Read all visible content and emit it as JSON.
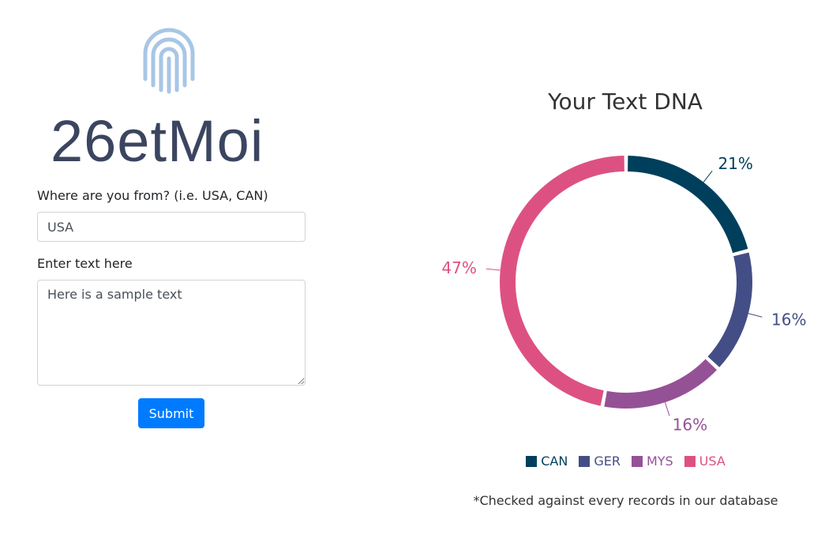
{
  "logo": {
    "text": "26etMoi",
    "icon": "fingerprint-icon"
  },
  "form": {
    "country_label": "Where are you from? (i.e. USA, CAN)",
    "country_value": "USA",
    "text_label": "Enter text here",
    "text_value": "Here is a sample text",
    "submit_label": "Submit"
  },
  "chart_data": {
    "type": "pie",
    "title": "Your Text DNA",
    "categories": [
      "CAN",
      "GER",
      "MYS",
      "USA"
    ],
    "values": [
      21,
      16,
      16,
      47
    ],
    "labels": [
      "21%",
      "16%",
      "16%",
      "47%"
    ],
    "colors": [
      "#003f5c",
      "#444e86",
      "#955196",
      "#dd5182"
    ],
    "donut": true,
    "legend_position": "bottom"
  },
  "footnote": "*Checked against every records in our database"
}
